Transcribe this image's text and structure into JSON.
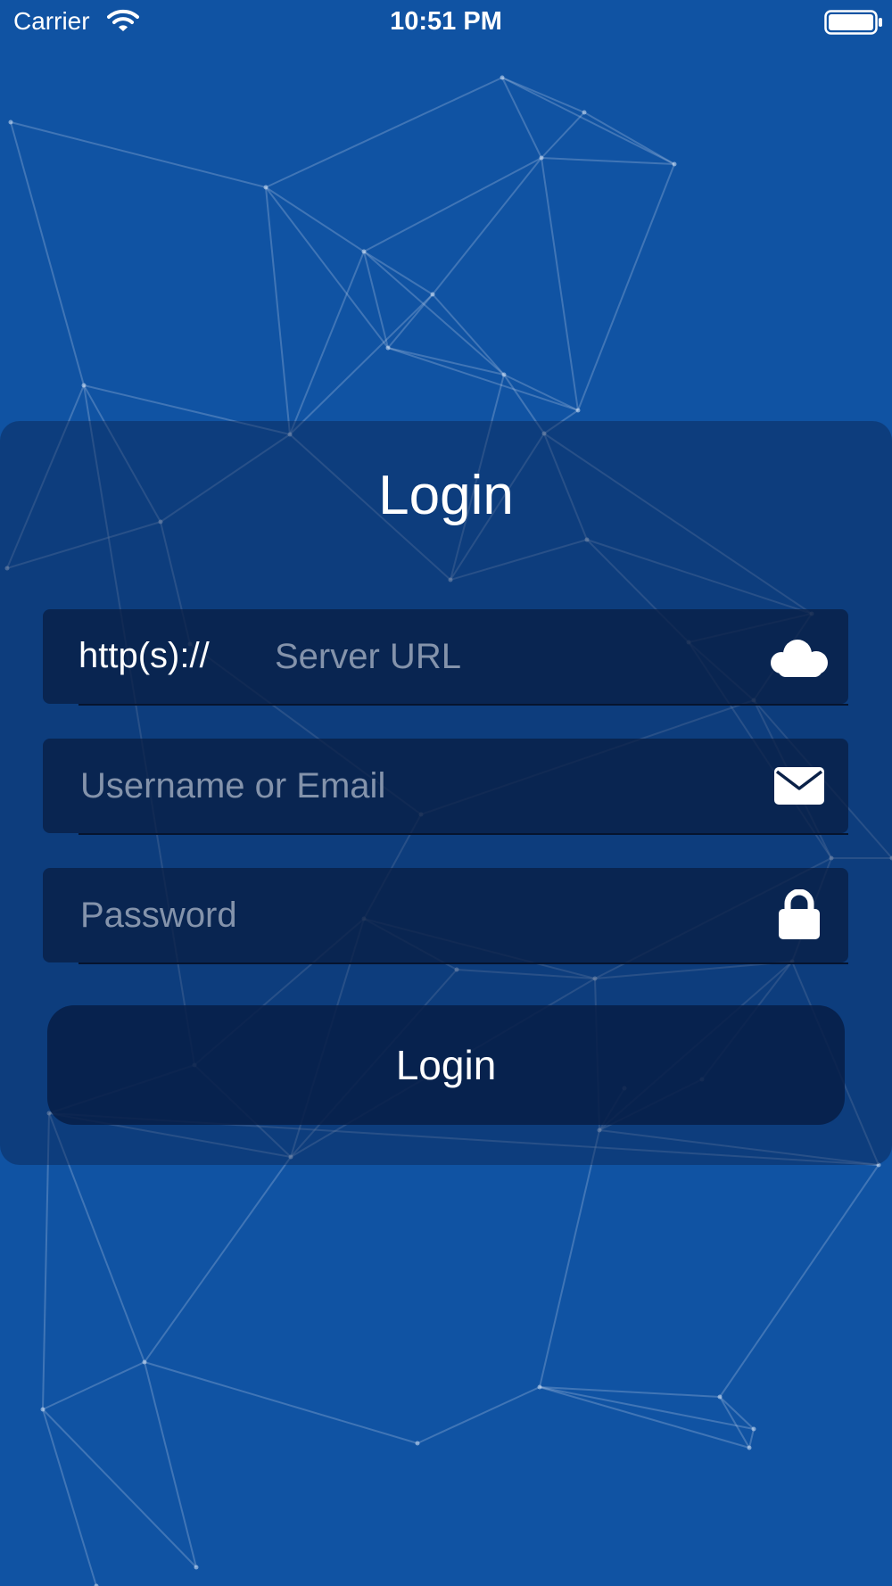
{
  "status_bar": {
    "carrier": "Carrier",
    "time": "10:51 PM",
    "wifi_icon": "wifi-icon",
    "battery_icon": "battery-full-icon"
  },
  "login": {
    "title": "Login",
    "server": {
      "prefix": "http(s)://",
      "placeholder": "Server URL",
      "value": "",
      "icon": "cloud-icon"
    },
    "username": {
      "placeholder": "Username or Email",
      "value": "",
      "icon": "envelope-icon"
    },
    "password": {
      "placeholder": "Password",
      "value": "",
      "icon": "lock-icon"
    },
    "button_label": "Login"
  },
  "colors": {
    "background": "#1053a3",
    "field_background": "#0a2148",
    "placeholder": "#8493ab",
    "text": "#ffffff"
  }
}
